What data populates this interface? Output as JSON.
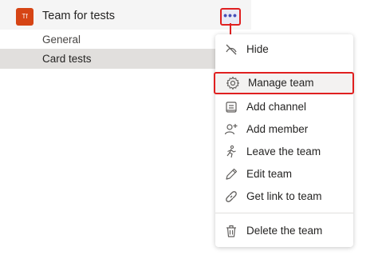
{
  "team": {
    "avatar_text": "Tf",
    "name": "Team for tests",
    "more_label": "•••",
    "channels": [
      {
        "label": "General"
      },
      {
        "label": "Card tests"
      }
    ]
  },
  "menu": {
    "items": [
      {
        "label": "Hide",
        "icon": "hide-icon"
      },
      {
        "label": "Manage team",
        "icon": "gear-icon"
      },
      {
        "label": "Add channel",
        "icon": "channel-icon"
      },
      {
        "label": "Add member",
        "icon": "add-person-icon"
      },
      {
        "label": "Leave the team",
        "icon": "leave-icon"
      },
      {
        "label": "Edit team",
        "icon": "pencil-icon"
      },
      {
        "label": "Get link to team",
        "icon": "link-icon"
      },
      {
        "label": "Delete the team",
        "icon": "trash-icon"
      }
    ]
  },
  "colors": {
    "highlight_annotation": "#e02020",
    "avatar": "#d64515",
    "selected_channel_bg": "#e1dfdd"
  }
}
